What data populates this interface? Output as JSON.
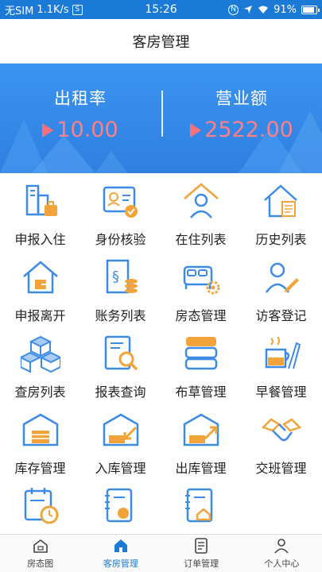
{
  "status_bar": {
    "carrier": "无SIM",
    "speed": "1.1K/s",
    "carrier_badge": "S",
    "time": "15:26",
    "nfc": "N",
    "battery": "91%"
  },
  "header": {
    "title": "客房管理"
  },
  "banner": {
    "occupancy_label": "出租率",
    "occupancy_value": "10.00",
    "revenue_label": "营业额",
    "revenue_value": "2522.00"
  },
  "menu": [
    {
      "label": "申报入住",
      "icon": "check-in-icon"
    },
    {
      "label": "身份核验",
      "icon": "id-verify-icon"
    },
    {
      "label": "在住列表",
      "icon": "in-house-icon"
    },
    {
      "label": "历史列表",
      "icon": "history-icon"
    },
    {
      "label": "申报离开",
      "icon": "check-out-icon"
    },
    {
      "label": "账务列表",
      "icon": "accounts-icon"
    },
    {
      "label": "房态管理",
      "icon": "room-status-icon"
    },
    {
      "label": "访客登记",
      "icon": "visitor-icon"
    },
    {
      "label": "查房列表",
      "icon": "room-check-icon"
    },
    {
      "label": "报表查询",
      "icon": "report-icon"
    },
    {
      "label": "布草管理",
      "icon": "linen-icon"
    },
    {
      "label": "早餐管理",
      "icon": "breakfast-icon"
    },
    {
      "label": "库存管理",
      "icon": "inventory-icon"
    },
    {
      "label": "入库管理",
      "icon": "stock-in-icon"
    },
    {
      "label": "出库管理",
      "icon": "stock-out-icon"
    },
    {
      "label": "交班管理",
      "icon": "handover-icon"
    },
    {
      "label": "",
      "icon": "schedule-icon"
    },
    {
      "label": "",
      "icon": "notebook-money-icon"
    },
    {
      "label": "",
      "icon": "notebook-home-icon"
    }
  ],
  "tabs": [
    {
      "label": "房态图",
      "icon": "hotel-icon"
    },
    {
      "label": "客房管理",
      "icon": "room-icon"
    },
    {
      "label": "订单管理",
      "icon": "order-icon"
    },
    {
      "label": "个人中心",
      "icon": "person-icon"
    }
  ],
  "colors": {
    "primary": "#1a7ad6",
    "banner": "#3c94f0",
    "accent_red": "#ff7f86",
    "icon_blue": "#3d8be6",
    "icon_orange": "#f2a33a"
  }
}
